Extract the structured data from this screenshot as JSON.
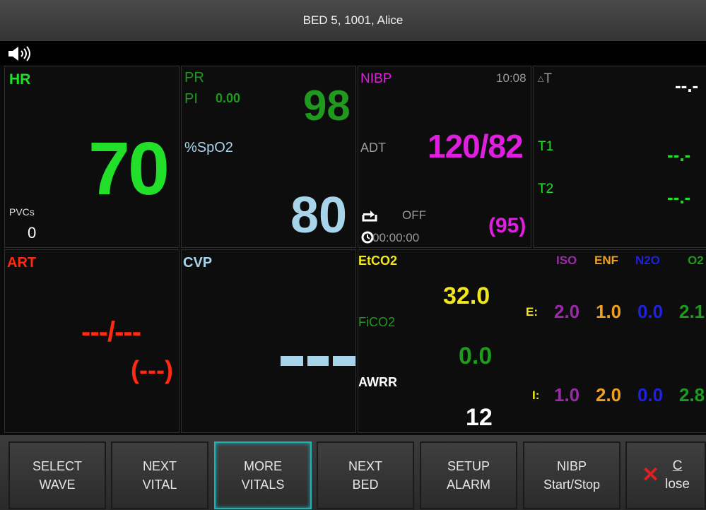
{
  "title": "BED 5, 1001,  Alice",
  "icons": {
    "speaker": "speaker-volume-icon",
    "cycle": "cycle-icon",
    "timer": "timer-icon",
    "close": "close-x-icon"
  },
  "hr": {
    "label": "HR",
    "value": "70",
    "pvc_label": "PVCs",
    "pvc_value": "0"
  },
  "spo2": {
    "pr_label": "PR",
    "pi_label": "PI",
    "pi_value": "0.00",
    "pr_value": "98",
    "label": "%SpO2",
    "value": "80"
  },
  "nibp": {
    "label": "NIBP",
    "time": "10:08",
    "mode": "ADT",
    "value": "120/82",
    "cycle_status": "OFF",
    "timer": "00:00:00",
    "mean": "(95)"
  },
  "temp": {
    "delta_label": "T",
    "delta_value": "--.-",
    "t1_label": "T1",
    "t1_value": "--.-",
    "t2_label": "T2",
    "t2_value": "--.-"
  },
  "art": {
    "label": "ART",
    "value": "---/---",
    "mean": "(---)"
  },
  "cvp": {
    "label": "CVP"
  },
  "co2": {
    "etco2_label": "EtCO2",
    "etco2_value": "32.0",
    "fico2_label": "FiCO2",
    "fico2_value": "0.0",
    "awrr_label": "AWRR",
    "awrr_value": "12"
  },
  "gas": {
    "headers": [
      "ISO",
      "ENF",
      "N2O",
      "O2"
    ],
    "e_label": "E:",
    "e_values": [
      "2.0",
      "1.0",
      "0.0",
      "2.1"
    ],
    "i_label": "I:",
    "i_values": [
      "1.0",
      "2.0",
      "0.0",
      "2.8"
    ]
  },
  "buttons": [
    {
      "line1": "SELECT",
      "line2": "WAVE"
    },
    {
      "line1": "NEXT",
      "line2": "VITAL"
    },
    {
      "line1": "MORE",
      "line2": "VITALS"
    },
    {
      "line1": "NEXT",
      "line2": "BED"
    },
    {
      "line1": "SETUP",
      "line2": "ALARM"
    },
    {
      "line1": "NIBP",
      "line2": "Start/Stop"
    }
  ],
  "close": {
    "first_letter": "C",
    "rest": "lose"
  },
  "colors": {
    "hr": "#22e02a",
    "pr": "#1f9a1f",
    "spo2": "#a8d4ea",
    "nibp": "#e01ee0",
    "temp": "#22e02a",
    "art": "#ff2a10",
    "cvp": "#a8d4ea",
    "etco2": "#f2e61c",
    "iso": "#9a2aa8",
    "enf": "#f0a020",
    "n2o": "#2020e0",
    "o2": "#1f9a1f",
    "active": "#1fb3b8"
  }
}
